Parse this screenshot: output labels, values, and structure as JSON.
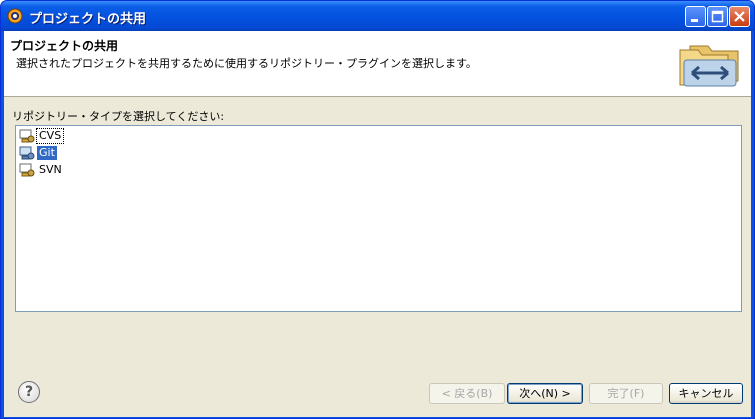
{
  "window": {
    "title": "プロジェクトの共用"
  },
  "header": {
    "title": "プロジェクトの共用",
    "description": "選択されたプロジェクトを共用するために使用するリポジトリー・プラグインを選択します。"
  },
  "prompt": "リポジトリー・タイプを選択してください:",
  "repository_types": [
    {
      "label": "CVS",
      "selected": false,
      "focused": true
    },
    {
      "label": "Git",
      "selected": true,
      "focused": false
    },
    {
      "label": "SVN",
      "selected": false,
      "focused": false
    }
  ],
  "buttons": {
    "back": "< 戻る(B)",
    "next": "次へ(N) >",
    "finish": "完了(F)",
    "cancel": "キャンセル"
  },
  "colors": {
    "selection": "#316ac5",
    "titlebar": "#0350de",
    "dialog_bg": "#ece9d8"
  }
}
